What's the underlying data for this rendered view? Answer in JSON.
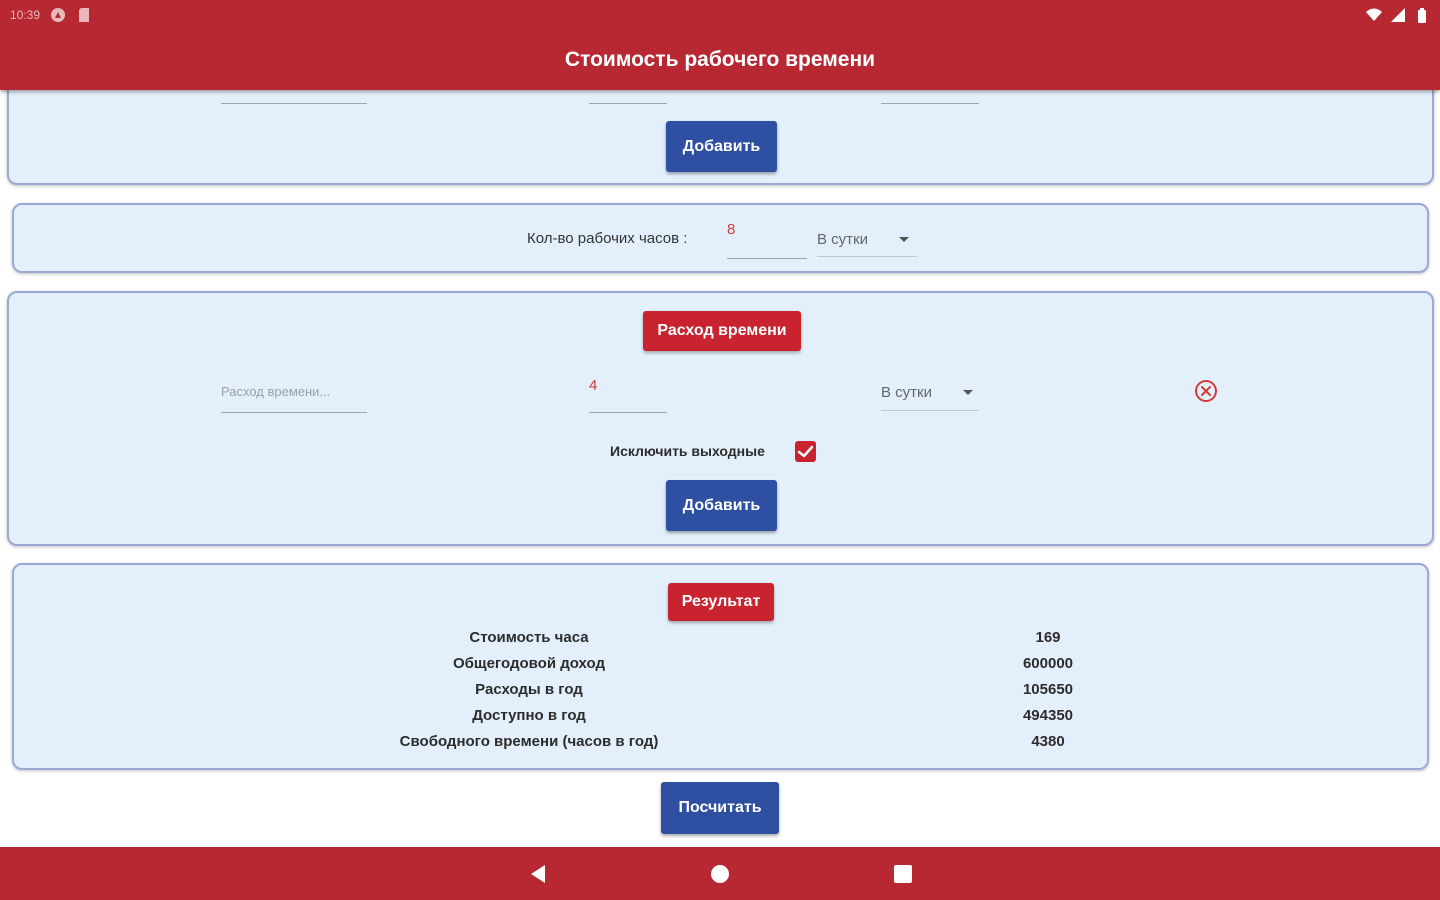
{
  "status_bar": {
    "time": "10:39",
    "colors": {
      "bar": "#b72832"
    },
    "left_icons": [
      "app-notification-icon",
      "sd-card-icon"
    ],
    "right_icons": [
      "wifi-icon",
      "cell-signal-icon",
      "battery-icon"
    ]
  },
  "app_bar": {
    "title": "Стоимость рабочего времени"
  },
  "income_card": {
    "add_label": "Добавить"
  },
  "hours_card": {
    "label": "Кол-во рабочих часов :",
    "value": "8",
    "period": "В сутки"
  },
  "expense_card": {
    "header": "Расход времени",
    "name_placeholder": "Расход времени...",
    "amount": "4",
    "period": "В сутки",
    "exclude_weekends_label": "Исключить выходные",
    "exclude_weekends_checked": true,
    "add_label": "Добавить"
  },
  "result_card": {
    "header": "Результат",
    "rows": [
      {
        "label": "Стоимость часа",
        "value": "169"
      },
      {
        "label": "Общегодовой доход",
        "value": "600000"
      },
      {
        "label": "Расходы в год",
        "value": "105650"
      },
      {
        "label": "Доступно в год",
        "value": "494350"
      },
      {
        "label": "Свободного времени (часов в год)",
        "value": "4380"
      }
    ]
  },
  "calculate_label": "Посчитать",
  "nav_bar": {
    "icons": [
      "back-icon",
      "home-icon",
      "recents-icon"
    ]
  },
  "colors": {
    "accent_red": "#b72832",
    "button_blue": "#2f4fa2",
    "card_bg": "#e3f0fc",
    "input_red_text": "#d33a3a"
  }
}
